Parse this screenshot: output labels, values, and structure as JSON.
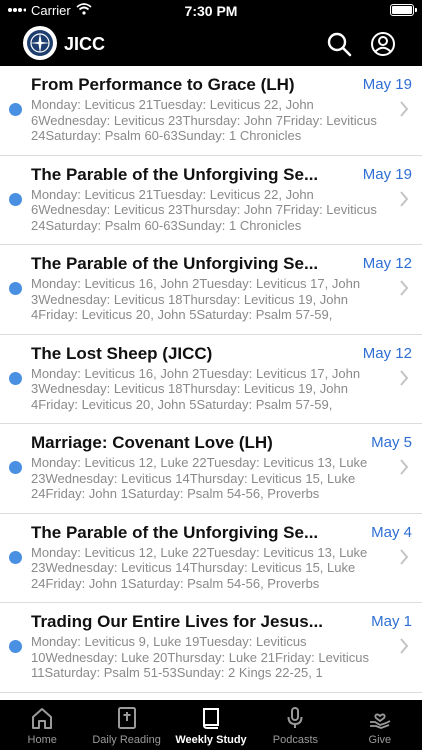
{
  "status_bar": {
    "carrier": "Carrier",
    "time": "7:30 PM"
  },
  "header": {
    "title": "JICC"
  },
  "items": [
    {
      "title": "From Performance to Grace (LH)",
      "date": "May 19",
      "description": "Monday: Leviticus 21Tuesday: Leviticus 22, John 6Wednesday: Leviticus 23Thursday: John 7Friday: Leviticus 24Saturday: Psalm 60-63Sunday: 1 Chronicles"
    },
    {
      "title": "The Parable of the Unforgiving Se...",
      "date": "May 19",
      "description": "Monday: Leviticus 21Tuesday: Leviticus 22, John 6Wednesday: Leviticus 23Thursday: John 7Friday: Leviticus 24Saturday: Psalm 60-63Sunday: 1 Chronicles"
    },
    {
      "title": "The Parable of the Unforgiving Se...",
      "date": "May 12",
      "description": "Monday: Leviticus 16, John 2Tuesday: Leviticus 17, John 3Wednesday: Leviticus 18Thursday: Leviticus 19, John 4Friday: Leviticus 20, John 5Saturday: Psalm 57-59,"
    },
    {
      "title": "The Lost Sheep (JICC)",
      "date": "May 12",
      "description": "Monday: Leviticus 16, John 2Tuesday: Leviticus 17, John 3Wednesday: Leviticus 18Thursday: Leviticus 19, John 4Friday: Leviticus 20, John 5Saturday: Psalm 57-59,"
    },
    {
      "title": "Marriage: Covenant Love (LH)",
      "date": "May 5",
      "description": "Monday: Leviticus 12, Luke 22Tuesday: Leviticus 13, Luke 23Wednesday: Leviticus 14Thursday: Leviticus 15, Luke 24Friday: John 1Saturday: Psalm 54-56, Proverbs"
    },
    {
      "title": "The Parable of the Unforgiving Se...",
      "date": "May 4",
      "description": "Monday: Leviticus 12, Luke 22Tuesday: Leviticus 13, Luke 23Wednesday: Leviticus 14Thursday: Leviticus 15, Luke 24Friday: John 1Saturday: Psalm 54-56, Proverbs"
    },
    {
      "title": "Trading Our Entire Lives for Jesus...",
      "date": "May 1",
      "description": "Monday: Leviticus 9, Luke 19Tuesday: Leviticus 10Wednesday: Luke 20Thursday: Luke 21Friday: Leviticus 11Saturday: Psalm 51-53Sunday: 2 Kings 22-25, 1"
    }
  ],
  "tabs": [
    {
      "label": "Home",
      "icon": "home-icon"
    },
    {
      "label": "Daily Reading",
      "icon": "bible-icon"
    },
    {
      "label": "Weekly Study",
      "icon": "book-icon"
    },
    {
      "label": "Podcasts",
      "icon": "microphone-icon"
    },
    {
      "label": "Give",
      "icon": "giving-hand-icon"
    }
  ],
  "active_tab": "Weekly Study",
  "colors": {
    "accent": "#2f6fd3",
    "unread_dot": "#4a90e2",
    "bar_background": "#000000"
  }
}
